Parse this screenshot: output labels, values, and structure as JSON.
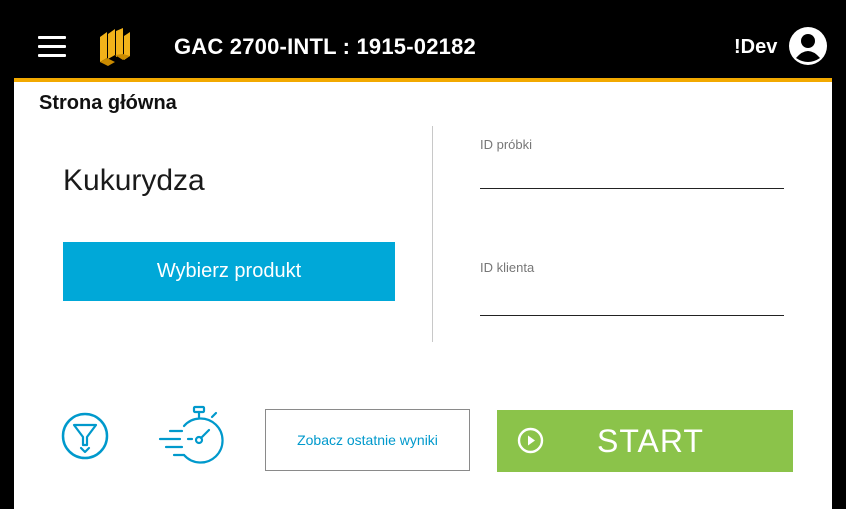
{
  "header": {
    "device_title": "GAC 2700-INTL : 1915-02182",
    "user_name": "!Dev",
    "icons": {
      "menu": "hamburger-menu-icon",
      "logo": "brand-logo",
      "user": "user-account-icon"
    },
    "accent_color": "#f2a900"
  },
  "main": {
    "page_title": "Strona główna",
    "product_name": "Kukurydza",
    "select_product_label": "Wybierz produkt",
    "sample_id": {
      "label": "ID próbki",
      "value": ""
    },
    "client_id": {
      "label": "ID klienta",
      "value": ""
    }
  },
  "footer": {
    "filter_icon": "funnel-icon",
    "timer_icon": "stopwatch-icon",
    "recent_results_label": "Zobacz ostatnie wyniki",
    "start_label": "START"
  },
  "colors": {
    "primary_blue": "#00a8d8",
    "start_green": "#8bc34a",
    "header_bg": "#000000"
  }
}
